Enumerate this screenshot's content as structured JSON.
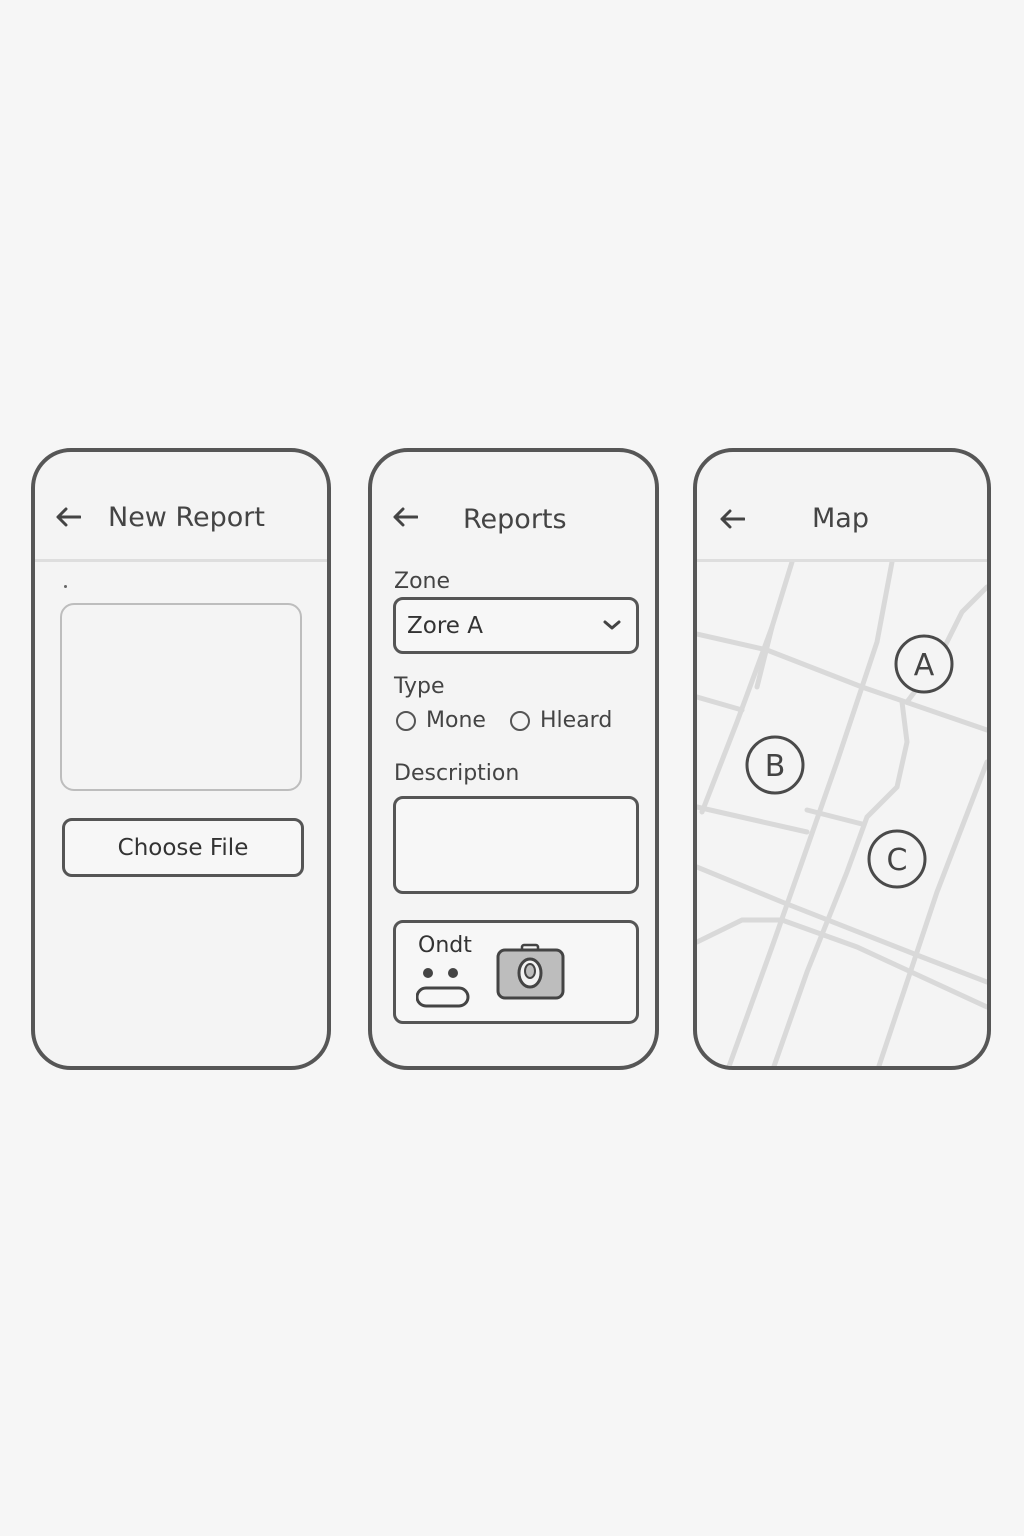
{
  "screens": {
    "new_report": {
      "title": "New Report",
      "choose_file_label": "Choose File"
    },
    "reports": {
      "title": "Reports",
      "zone_label": "Zone",
      "zone_value": "Zore A",
      "type_label": "Type",
      "type_options": [
        "Mone",
        "Hleard"
      ],
      "description_label": "Description",
      "attachment_label": "Ondt"
    },
    "map": {
      "title": "Map",
      "markers": [
        "A",
        "B",
        "C"
      ]
    }
  },
  "colors": {
    "background": "#f6f6f6",
    "frame": "#565656",
    "road": "#d9d9d9",
    "camera_fill": "#bdbdbd"
  },
  "icons": [
    "back-arrow-icon",
    "chevron-down-icon",
    "emoji-icon",
    "camera-icon"
  ]
}
